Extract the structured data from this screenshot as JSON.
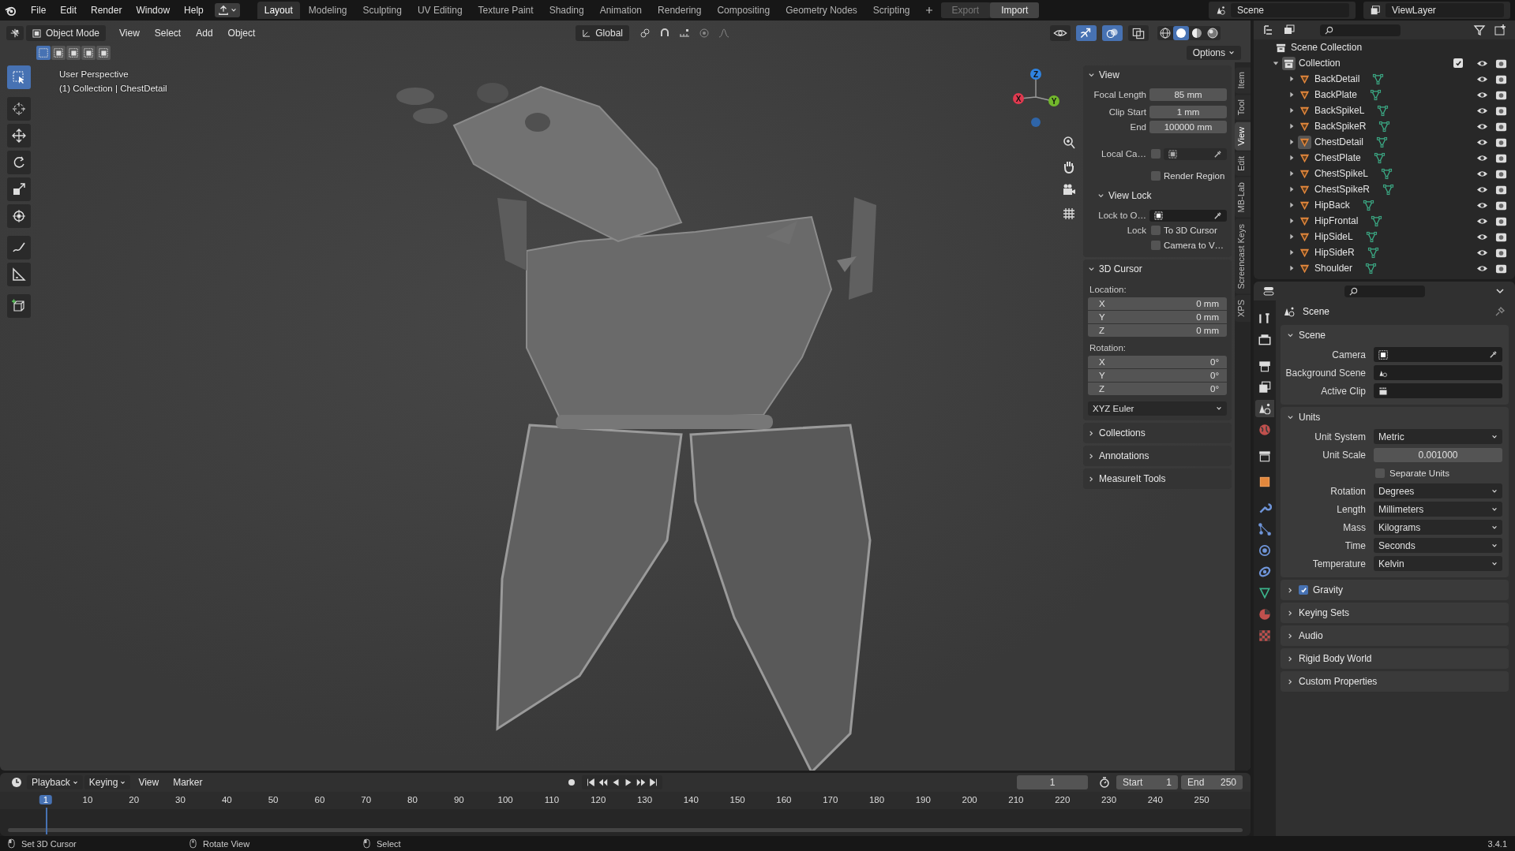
{
  "topbar": {
    "menus": [
      "File",
      "Edit",
      "Render",
      "Window",
      "Help"
    ],
    "workspaces": [
      {
        "label": "Layout",
        "selected": true
      },
      {
        "label": "Modeling",
        "selected": false
      },
      {
        "label": "Sculpting",
        "selected": false
      },
      {
        "label": "UV Editing",
        "selected": false
      },
      {
        "label": "Texture Paint",
        "selected": false
      },
      {
        "label": "Shading",
        "selected": false
      },
      {
        "label": "Animation",
        "selected": false
      },
      {
        "label": "Rendering",
        "selected": false
      },
      {
        "label": "Compositing",
        "selected": false
      },
      {
        "label": "Geometry Nodes",
        "selected": false
      },
      {
        "label": "Scripting",
        "selected": false
      }
    ],
    "io_buttons": [
      {
        "label": "Export",
        "disabled": true
      },
      {
        "label": "Import",
        "disabled": false
      }
    ],
    "scene": "Scene",
    "view_layer": "ViewLayer"
  },
  "viewport": {
    "mode": "Object Mode",
    "menus": [
      "View",
      "Select",
      "Add",
      "Object"
    ],
    "orientation": "Global",
    "options": "Options",
    "info": [
      "User Perspective",
      "(1) Collection | ChestDetail"
    ],
    "gizmo_axes": [
      {
        "axis": "Z",
        "color": "#2f83e0"
      },
      {
        "axis": "X",
        "color": "#e0394f"
      },
      {
        "axis": "Y",
        "color": "#72b82c"
      }
    ],
    "select_modes": [
      {
        "selected": true
      },
      {
        "selected": false
      },
      {
        "selected": false
      },
      {
        "selected": false
      },
      {
        "selected": false
      }
    ],
    "toggles": [
      {
        "kind": "visibility",
        "on": false
      },
      {
        "kind": "gizmo",
        "on": true
      },
      {
        "kind": "overlay",
        "on": true
      },
      {
        "kind": "xray",
        "on": false
      }
    ],
    "shading": [
      {
        "kind": "wireframe",
        "selected": false
      },
      {
        "kind": "solid",
        "selected": true
      },
      {
        "kind": "material",
        "selected": false
      },
      {
        "kind": "rendered",
        "selected": false
      }
    ],
    "tools": [
      {
        "kind": "select",
        "selected": true
      },
      {
        "kind": "cursor",
        "selected": false
      },
      {
        "kind": "move",
        "selected": false
      },
      {
        "kind": "rotate",
        "selected": false
      },
      {
        "kind": "scale",
        "selected": false
      },
      {
        "kind": "transform",
        "selected": false
      },
      {
        "kind": "annotate",
        "selected": false
      },
      {
        "kind": "measure",
        "selected": false
      },
      {
        "kind": "add_cube",
        "selected": false
      }
    ]
  },
  "sidebar": {
    "tabs": [
      {
        "label": "Item",
        "selected": false
      },
      {
        "label": "Tool",
        "selected": false
      },
      {
        "label": "View",
        "selected": true
      },
      {
        "label": "Edit",
        "selected": false
      },
      {
        "label": "MB-Lab",
        "selected": false
      },
      {
        "label": "Screencast Keys",
        "selected": false
      },
      {
        "label": "XPS",
        "selected": false
      }
    ],
    "view": {
      "title": "View",
      "expanded": true,
      "fields": [
        {
          "label": "Focal Length",
          "value": "85 mm"
        },
        {
          "label": "Clip Start",
          "value": "1 mm"
        },
        {
          "label": "End",
          "value": "100000 mm"
        }
      ],
      "local_camera": {
        "label": "Local Ca…",
        "checked": false
      },
      "render_region": {
        "label": "Render Region",
        "checked": false
      },
      "view_lock": {
        "title": "View Lock",
        "expanded": true,
        "lock_to_object": "Lock to O…",
        "lock_label": "Lock",
        "options": [
          {
            "label": "To 3D Cursor",
            "checked": false
          },
          {
            "label": "Camera to V…",
            "checked": false
          }
        ]
      }
    },
    "cursor": {
      "title": "3D Cursor",
      "expanded": true,
      "location_label": "Location:",
      "location": [
        {
          "axis": "X",
          "value": "0 mm"
        },
        {
          "axis": "Y",
          "value": "0 mm"
        },
        {
          "axis": "Z",
          "value": "0 mm"
        }
      ],
      "rotation_label": "Rotation:",
      "rotation": [
        {
          "axis": "X",
          "value": "0°"
        },
        {
          "axis": "Y",
          "value": "0°"
        },
        {
          "axis": "Z",
          "value": "0°"
        }
      ],
      "rotation_mode": "XYZ Euler"
    },
    "panels": [
      {
        "title": "Collections",
        "expanded": false
      },
      {
        "title": "Annotations",
        "expanded": false
      },
      {
        "title": "MeasureIt Tools",
        "expanded": false
      }
    ]
  },
  "outliner": {
    "root": "Scene Collection",
    "collection": {
      "name": "Collection",
      "expanded": true,
      "checked": true,
      "children": [
        {
          "name": "BackDetail",
          "selected": false,
          "expanded": false
        },
        {
          "name": "BackPlate",
          "selected": false,
          "expanded": false
        },
        {
          "name": "BackSpikeL",
          "selected": false,
          "expanded": false
        },
        {
          "name": "BackSpikeR",
          "selected": false,
          "expanded": false
        },
        {
          "name": "ChestDetail",
          "selected": true,
          "expanded": false
        },
        {
          "name": "ChestPlate",
          "selected": false,
          "expanded": false
        },
        {
          "name": "ChestSpikeL",
          "selected": false,
          "expanded": false
        },
        {
          "name": "ChestSpikeR",
          "selected": false,
          "expanded": false
        },
        {
          "name": "HipBack",
          "selected": false,
          "expanded": false
        },
        {
          "name": "HipFrontal",
          "selected": false,
          "expanded": false
        },
        {
          "name": "HipSideL",
          "selected": false,
          "expanded": false
        },
        {
          "name": "HipSideR",
          "selected": false,
          "expanded": false
        },
        {
          "name": "Shoulder",
          "selected": false,
          "expanded": false
        }
      ]
    }
  },
  "properties": {
    "tabs": [
      {
        "kind": "tool",
        "selected": false
      },
      {
        "kind": "render",
        "selected": false
      },
      {
        "kind": "output",
        "selected": false
      },
      {
        "kind": "view_layer",
        "selected": false
      },
      {
        "kind": "scene",
        "selected": true
      },
      {
        "kind": "world",
        "selected": false
      },
      {
        "kind": "collection",
        "selected": false
      },
      {
        "kind": "object",
        "selected": false
      },
      {
        "kind": "modifiers",
        "selected": false
      },
      {
        "kind": "particles",
        "selected": false
      },
      {
        "kind": "physics",
        "selected": false
      },
      {
        "kind": "constraints",
        "selected": false
      },
      {
        "kind": "data",
        "selected": false
      },
      {
        "kind": "material",
        "selected": false
      },
      {
        "kind": "texture",
        "selected": false
      }
    ],
    "context": "Scene",
    "panels": [
      {
        "title": "Scene",
        "expanded": true,
        "rows": [
          {
            "label": "Camera",
            "kind": "object"
          },
          {
            "label": "Background Scene",
            "kind": "scene"
          },
          {
            "label": "Active Clip",
            "kind": "clip"
          }
        ]
      },
      {
        "title": "Units",
        "expanded": true,
        "rows": [
          {
            "label": "Unit System",
            "kind": "dropdown",
            "value": "Metric"
          },
          {
            "label": "Unit Scale",
            "kind": "number",
            "value": "0.001000"
          },
          {
            "label": "Separate Units",
            "kind": "checkbox",
            "checked": false
          },
          {
            "label": "Rotation",
            "kind": "dropdown",
            "value": "Degrees"
          },
          {
            "label": "Length",
            "kind": "dropdown",
            "value": "Millimeters"
          },
          {
            "label": "Mass",
            "kind": "dropdown",
            "value": "Kilograms"
          },
          {
            "label": "Time",
            "kind": "dropdown",
            "value": "Seconds"
          },
          {
            "label": "Temperature",
            "kind": "dropdown",
            "value": "Kelvin"
          }
        ]
      },
      {
        "title": "Gravity",
        "expanded": false,
        "checked": true
      },
      {
        "title": "Keying Sets",
        "expanded": false
      },
      {
        "title": "Audio",
        "expanded": false
      },
      {
        "title": "Rigid Body World",
        "expanded": false
      },
      {
        "title": "Custom Properties",
        "expanded": false
      }
    ]
  },
  "timeline": {
    "menus": [
      "Playback",
      "Keying",
      "View",
      "Marker"
    ],
    "current_frame": "1",
    "start": {
      "label": "Start",
      "value": "1"
    },
    "end": {
      "label": "End",
      "value": "250"
    },
    "ruler": [
      {
        "label": "1",
        "selected": true
      },
      {
        "label": "10",
        "selected": false
      },
      {
        "label": "20",
        "selected": false
      },
      {
        "label": "30",
        "selected": false
      },
      {
        "label": "40",
        "selected": false
      },
      {
        "label": "50",
        "selected": false
      },
      {
        "label": "60",
        "selected": false
      },
      {
        "label": "70",
        "selected": false
      },
      {
        "label": "80",
        "selected": false
      },
      {
        "label": "90",
        "selected": false
      },
      {
        "label": "100",
        "selected": false
      },
      {
        "label": "110",
        "selected": false
      },
      {
        "label": "120",
        "selected": false
      },
      {
        "label": "130",
        "selected": false
      },
      {
        "label": "140",
        "selected": false
      },
      {
        "label": "150",
        "selected": false
      },
      {
        "label": "160",
        "selected": false
      },
      {
        "label": "170",
        "selected": false
      },
      {
        "label": "180",
        "selected": false
      },
      {
        "label": "190",
        "selected": false
      },
      {
        "label": "200",
        "selected": false
      },
      {
        "label": "210",
        "selected": false
      },
      {
        "label": "220",
        "selected": false
      },
      {
        "label": "230",
        "selected": false
      },
      {
        "label": "240",
        "selected": false
      },
      {
        "label": "250",
        "selected": false
      }
    ]
  },
  "status_bar": {
    "items": [
      {
        "kind": "left",
        "label": "Set 3D Cursor"
      },
      {
        "kind": "middle",
        "label": "Rotate View"
      },
      {
        "kind": "left",
        "label": "Select"
      }
    ],
    "version": "3.4.1"
  }
}
